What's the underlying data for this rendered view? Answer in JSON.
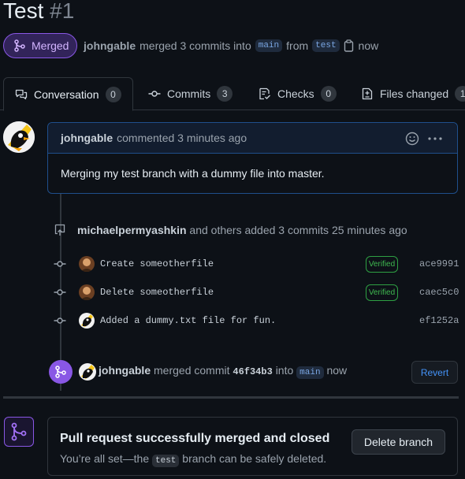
{
  "pr": {
    "title": "Test",
    "number": "#1",
    "state": "Merged",
    "author": "johngable",
    "merge_text": "merged 3 commits into",
    "base_branch": "main",
    "from_text": "from",
    "head_branch": "test",
    "time": "now"
  },
  "tabs": [
    {
      "label": "Conversation",
      "count": "0",
      "icon": "comment-discussion-icon"
    },
    {
      "label": "Commits",
      "count": "3",
      "icon": "git-commit-icon"
    },
    {
      "label": "Checks",
      "count": "0",
      "icon": "checklist-icon"
    },
    {
      "label": "Files changed",
      "count": "1",
      "icon": "file-diff-icon"
    }
  ],
  "comment": {
    "author": "johngable",
    "meta": "commented 3 minutes ago",
    "body": "Merging my test branch with a dummy file into master."
  },
  "commits_header": {
    "author": "michaelpermyashkin",
    "text": "and others added 3 commits",
    "time": "25 minutes ago"
  },
  "commits": [
    {
      "message": "Create someotherfile",
      "verified": "Verified",
      "sha": "ace9991"
    },
    {
      "message": "Delete someotherfile",
      "verified": "Verified",
      "sha": "caec5c0"
    },
    {
      "message": "Added a dummy.txt file for fun.",
      "verified": "",
      "sha": "ef1252a"
    }
  ],
  "merge_event": {
    "author": "johngable",
    "text": "merged commit",
    "sha": "46f34b3",
    "into": "into",
    "branch": "main",
    "time": "now",
    "revert_label": "Revert"
  },
  "merged_box": {
    "title": "Pull request successfully merged and closed",
    "desc_prefix": "You’re all set—the",
    "branch": "test",
    "desc_suffix": "branch can be safely deleted.",
    "delete_label": "Delete branch"
  },
  "colors": {
    "merged_purple": "#8957e5",
    "link_blue": "#4493f8",
    "verified_green": "#3fb950"
  }
}
